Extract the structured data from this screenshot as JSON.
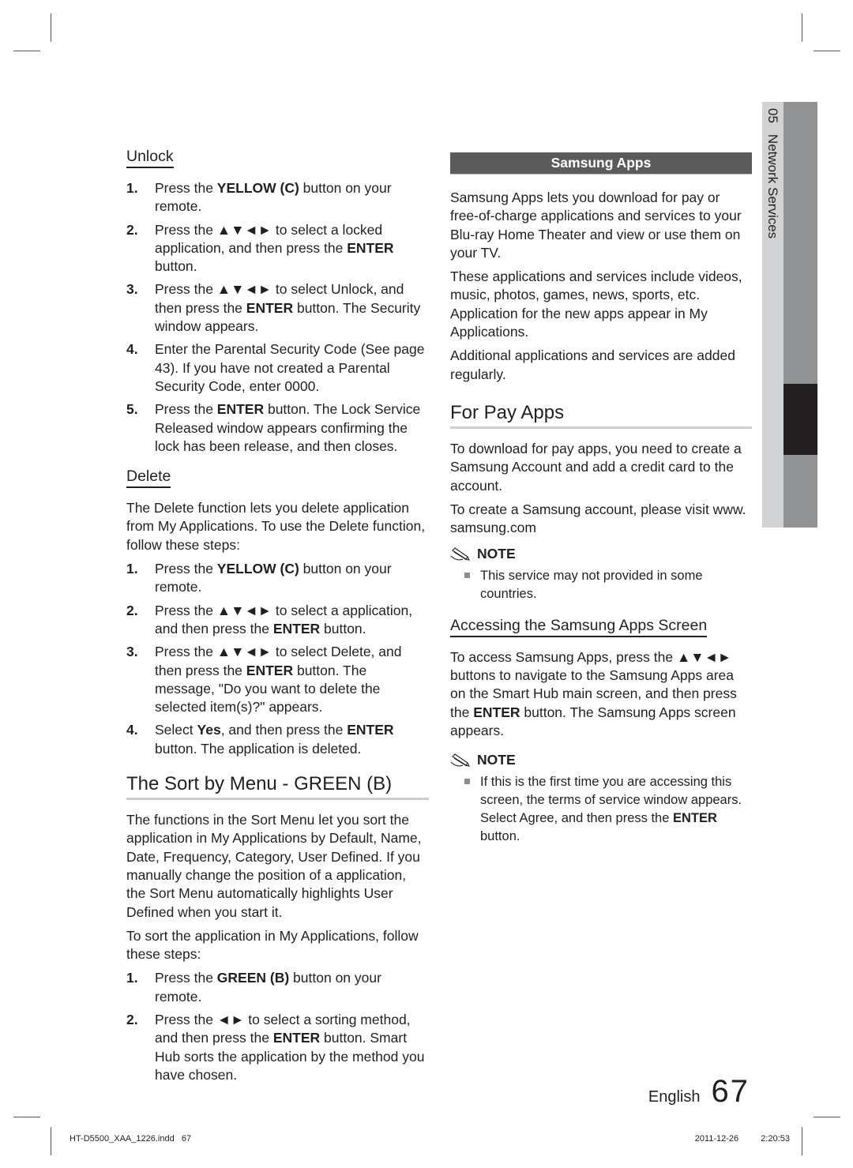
{
  "sidebar": {
    "chapter_number": "05",
    "chapter_title": "Network Services"
  },
  "left": {
    "unlock": {
      "heading": "Unlock",
      "steps": [
        {
          "num": "1.",
          "parts": [
            [
              "Press the ",
              false
            ],
            [
              "YELLOW (C)",
              true
            ],
            [
              " button on your remote.",
              false
            ]
          ]
        },
        {
          "num": "2.",
          "parts": [
            [
              "Press the ▲▼◄► to select a locked application, and then press the ",
              false
            ],
            [
              "ENTER",
              true
            ],
            [
              " button.",
              false
            ]
          ]
        },
        {
          "num": "3.",
          "parts": [
            [
              "Press the ▲▼◄► to select Unlock, and then press the ",
              false
            ],
            [
              "ENTER",
              true
            ],
            [
              " button. The Security window appears.",
              false
            ]
          ]
        },
        {
          "num": "4.",
          "parts": [
            [
              "Enter the Parental Security Code (See page 43). If you have not created a Parental Security Code, enter 0000.",
              false
            ]
          ]
        },
        {
          "num": "5.",
          "parts": [
            [
              "Press the ",
              false
            ],
            [
              "ENTER",
              true
            ],
            [
              " button. The Lock Service Released window appears confirming the lock has been release, and then closes.",
              false
            ]
          ]
        }
      ]
    },
    "delete": {
      "heading": "Delete",
      "intro": "The Delete function lets you delete application from My Applications. To use the Delete function, follow these steps:",
      "steps": [
        {
          "num": "1.",
          "parts": [
            [
              "Press the ",
              false
            ],
            [
              "YELLOW (C)",
              true
            ],
            [
              " button on your remote.",
              false
            ]
          ]
        },
        {
          "num": "2.",
          "parts": [
            [
              "Press the ▲▼◄► to select a application, and then press the ",
              false
            ],
            [
              "ENTER",
              true
            ],
            [
              " button.",
              false
            ]
          ]
        },
        {
          "num": "3.",
          "parts": [
            [
              "Press the ▲▼◄► to select Delete, and then press the ",
              false
            ],
            [
              "ENTER",
              true
            ],
            [
              " button. The message, \"Do you want to delete the selected item(s)?\" appears.",
              false
            ]
          ]
        },
        {
          "num": "4.",
          "parts": [
            [
              "Select ",
              false
            ],
            [
              "Yes",
              true
            ],
            [
              ", and then press the ",
              false
            ],
            [
              "ENTER",
              true
            ],
            [
              " button. The application is deleted.",
              false
            ]
          ]
        }
      ]
    },
    "sort": {
      "heading": "The Sort by Menu - GREEN (B)",
      "para1": "The functions in the Sort Menu let you sort the application in My Applications by Default, Name, Date, Frequency, Category, User Defined. If you manually change the position of a application, the Sort Menu automatically highlights User Defined when you start it.",
      "para2": "To sort the application in My Applications, follow these steps:",
      "steps": [
        {
          "num": "1.",
          "parts": [
            [
              "Press the ",
              false
            ],
            [
              "GREEN (B)",
              true
            ],
            [
              " button on your remote.",
              false
            ]
          ]
        },
        {
          "num": "2.",
          "parts": [
            [
              "Press the ◄► to select a sorting method, and then press the ",
              false
            ],
            [
              "ENTER",
              true
            ],
            [
              " button. Smart Hub sorts the application by the method you have chosen.",
              false
            ]
          ]
        }
      ]
    }
  },
  "right": {
    "band": "Samsung Apps",
    "intro1": "Samsung Apps lets you download for pay or free-of-charge applications and services to your Blu-ray Home Theater and view or use them on your TV.",
    "intro2": "These applications and services include videos, music, photos, games, news, sports, etc. Application for the new apps appear in My Applications.",
    "intro3": "Additional applications and services are added regularly.",
    "forpay": {
      "heading": "For Pay Apps",
      "para1": "To download for pay apps, you need to create a Samsung Account and add a credit card to the account.",
      "para2": "To create a Samsung account, please visit www. samsung.com",
      "note_label": "NOTE",
      "note_items": [
        "This service may not provided in some countries."
      ]
    },
    "accessing": {
      "heading": "Accessing the Samsung Apps Screen",
      "para_parts": [
        [
          "To access Samsung Apps, press the ▲▼◄► buttons to navigate to the Samsung Apps area on the Smart Hub main screen, and then press the ",
          false
        ],
        [
          "ENTER",
          true
        ],
        [
          " button. The Samsung Apps screen appears.",
          false
        ]
      ],
      "note_label": "NOTE",
      "note_parts": [
        [
          "If this is the first time you are accessing this screen, the terms of service window appears. Select Agree, and then press the ",
          false
        ],
        [
          "ENTER",
          true
        ],
        [
          " button.",
          false
        ]
      ]
    }
  },
  "footer": {
    "language": "English",
    "page_number": "67"
  },
  "slug": {
    "file": "HT-D5500_XAA_1226.indd   67",
    "date": "2011-12-26",
    "time": "2:20:53"
  }
}
